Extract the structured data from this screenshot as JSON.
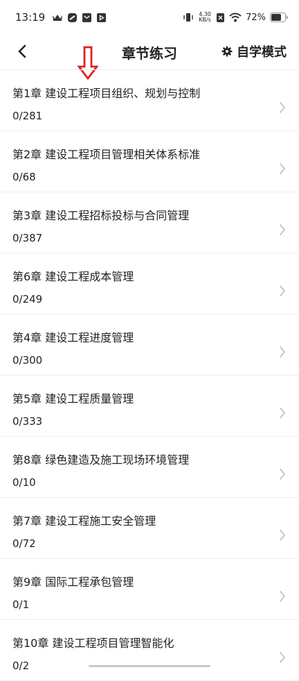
{
  "status_bar": {
    "time": "13:19",
    "net_speed_value": "4.30",
    "net_speed_unit": "KB/s",
    "battery": "72%",
    "icons": [
      "crown-icon",
      "app-icon",
      "mail-icon",
      "video-icon",
      "vibrate-icon",
      "wifi-icon",
      "sim-off-icon",
      "battery-icon"
    ]
  },
  "nav": {
    "title": "章节练习",
    "mode_label": "自学模式",
    "mode_icon": "gear-icon",
    "back_icon": "chevron-left-icon"
  },
  "overlay": {
    "arrow_icon": "down-arrow-icon",
    "arrow_color": "#e02020"
  },
  "chapters": [
    {
      "title": "第1章 建设工程项目组织、规划与控制",
      "count": "0/281"
    },
    {
      "title": "第2章 建设工程项目管理相关体系标准",
      "count": "0/68"
    },
    {
      "title": "第3章 建设工程招标投标与合同管理",
      "count": "0/387"
    },
    {
      "title": "第6章 建设工程成本管理",
      "count": "0/249"
    },
    {
      "title": "第4章 建设工程进度管理",
      "count": "0/300"
    },
    {
      "title": "第5章 建设工程质量管理",
      "count": "0/333"
    },
    {
      "title": "第8章 绿色建造及施工现场环境管理",
      "count": "0/10"
    },
    {
      "title": "第7章 建设工程施工安全管理",
      "count": "0/72"
    },
    {
      "title": "第9章 国际工程承包管理",
      "count": "0/1"
    },
    {
      "title": "第10章 建设工程项目管理智能化",
      "count": "0/2"
    }
  ]
}
